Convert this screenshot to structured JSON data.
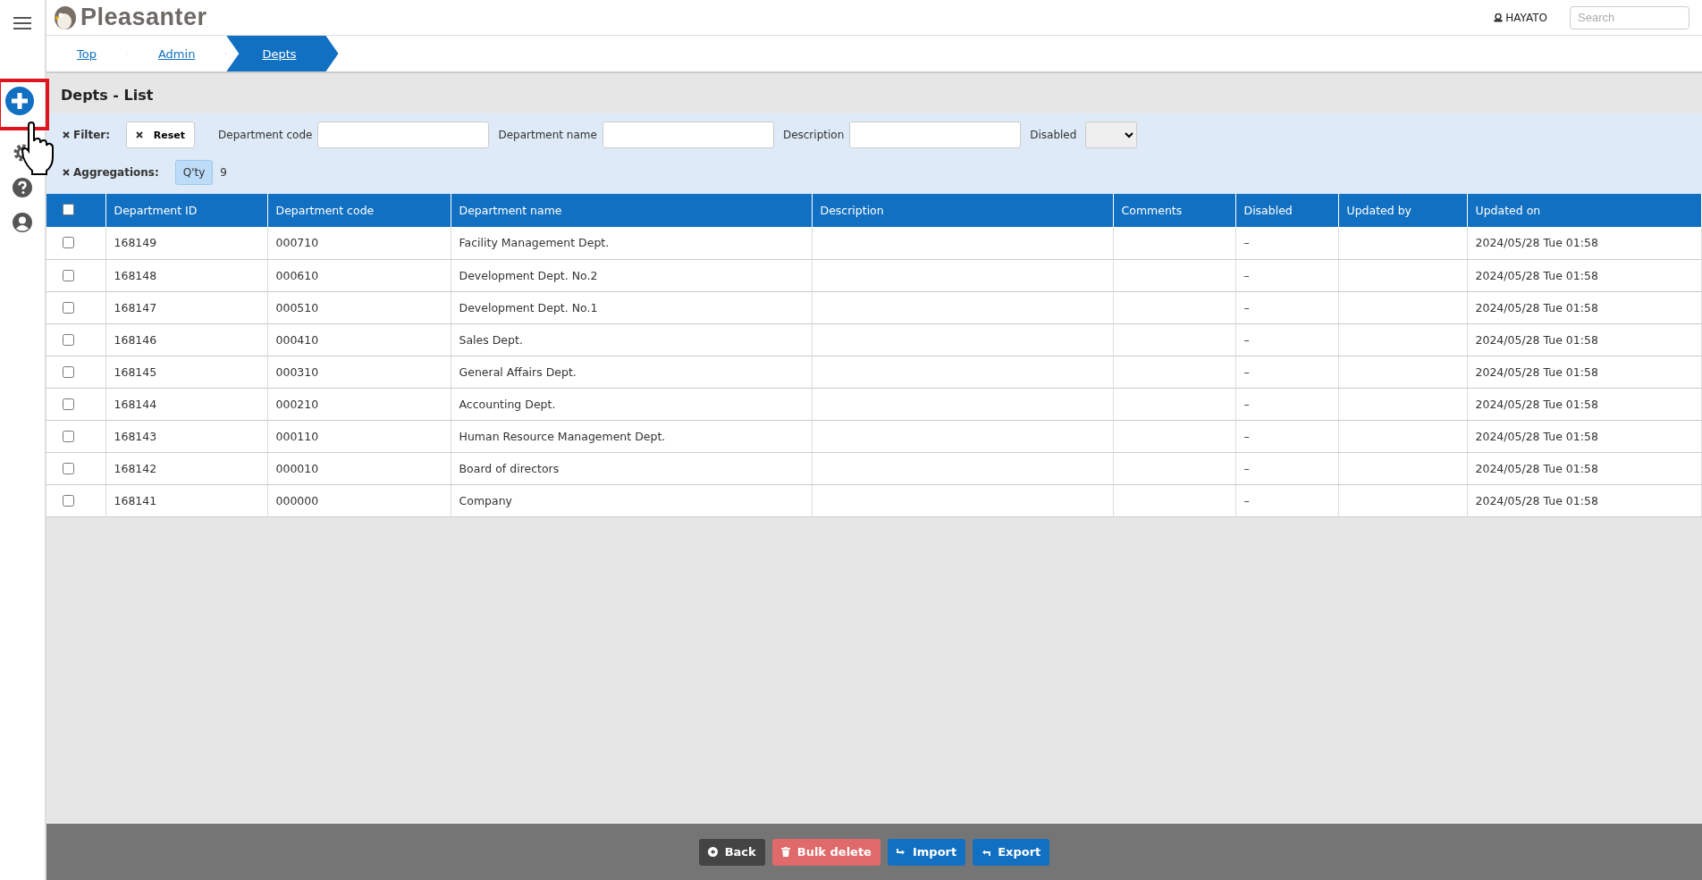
{
  "header": {
    "logo": "Pleasanter",
    "user": "HAYATO",
    "search_placeholder": "Search"
  },
  "breadcrumbs": [
    {
      "label": "Top",
      "selected": false
    },
    {
      "label": "Admin",
      "selected": false
    },
    {
      "label": "Depts",
      "selected": true
    }
  ],
  "title": "Depts - List",
  "filter": {
    "label": "Filter:",
    "reset": "Reset",
    "fields": [
      {
        "label": "Department code",
        "kind": "text"
      },
      {
        "label": "Department name",
        "kind": "text"
      },
      {
        "label": "Description",
        "kind": "text"
      },
      {
        "label": "Disabled",
        "kind": "select"
      }
    ]
  },
  "aggregations": {
    "label": "Aggregations:",
    "tag": "Q'ty",
    "count": "9"
  },
  "table": {
    "all_checked": false,
    "columns": [
      "Department ID",
      "Department code",
      "Department name",
      "Description",
      "Comments",
      "Disabled",
      "Updated by",
      "Updated on"
    ],
    "rows": [
      {
        "checked": false,
        "cells": [
          "168149",
          "000710",
          "Facility Management Dept.",
          "",
          "",
          "–",
          "",
          "2024/05/28 Tue 01:58"
        ]
      },
      {
        "checked": false,
        "cells": [
          "168148",
          "000610",
          "Development Dept. No.2",
          "",
          "",
          "–",
          "",
          "2024/05/28 Tue 01:58"
        ]
      },
      {
        "checked": false,
        "cells": [
          "168147",
          "000510",
          "Development Dept. No.1",
          "",
          "",
          "–",
          "",
          "2024/05/28 Tue 01:58"
        ]
      },
      {
        "checked": false,
        "cells": [
          "168146",
          "000410",
          "Sales Dept.",
          "",
          "",
          "–",
          "",
          "2024/05/28 Tue 01:58"
        ]
      },
      {
        "checked": false,
        "cells": [
          "168145",
          "000310",
          "General Affairs Dept.",
          "",
          "",
          "–",
          "",
          "2024/05/28 Tue 01:58"
        ]
      },
      {
        "checked": false,
        "cells": [
          "168144",
          "000210",
          "Accounting Dept.",
          "",
          "",
          "–",
          "",
          "2024/05/28 Tue 01:58"
        ]
      },
      {
        "checked": false,
        "cells": [
          "168143",
          "000110",
          "Human Resource Management Dept.",
          "",
          "",
          "–",
          "",
          "2024/05/28 Tue 01:58"
        ]
      },
      {
        "checked": false,
        "cells": [
          "168142",
          "000010",
          "Board of directors",
          "",
          "",
          "–",
          "",
          "2024/05/28 Tue 01:58"
        ]
      },
      {
        "checked": false,
        "cells": [
          "168141",
          "000000",
          "Company",
          "",
          "",
          "–",
          "",
          "2024/05/28 Tue 01:58"
        ]
      }
    ]
  },
  "footer_buttons": [
    {
      "label": "Back",
      "kind": "back"
    },
    {
      "label": "Bulk delete",
      "kind": "delete"
    },
    {
      "label": "Import",
      "kind": "import"
    },
    {
      "label": "Export",
      "kind": "export"
    }
  ]
}
